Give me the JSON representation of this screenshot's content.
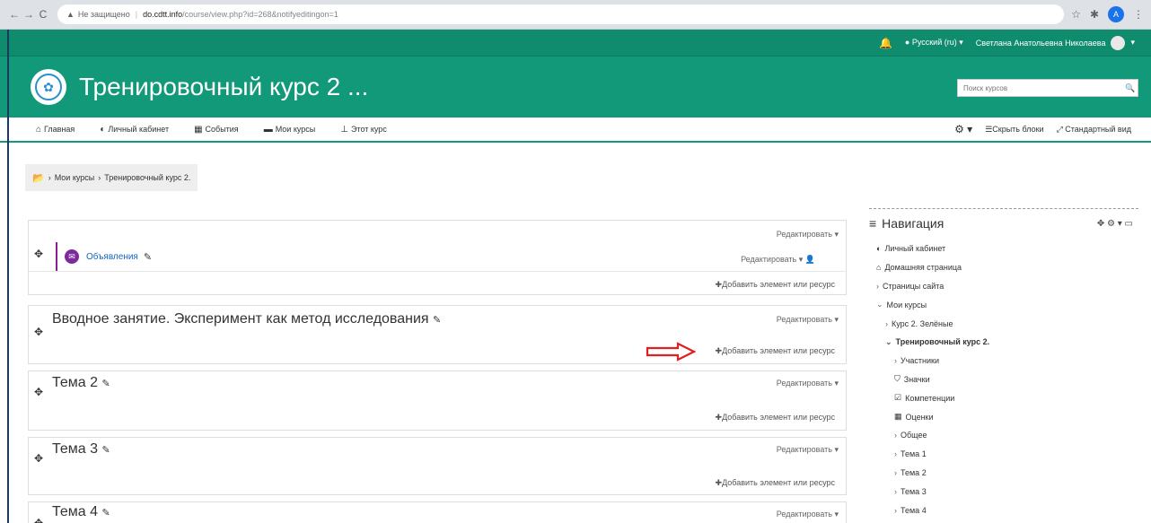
{
  "browser": {
    "back": "←",
    "forward": "→",
    "reload": "C",
    "security_warning": "Не защищено",
    "url_host": "do.cdtt.info",
    "url_path": "/course/view.php?id=268&notifyeditingon=1",
    "profile_initial": "A"
  },
  "topbar": {
    "language": "Русский (ru)",
    "user_name": "Светлана Анатольевна Николаева"
  },
  "header": {
    "course_title": "Тренировочный курс 2 ...",
    "search_placeholder": "Поиск курсов"
  },
  "navbar": {
    "items": [
      {
        "icon": "home-icon",
        "label": "Главная"
      },
      {
        "icon": "dashboard-icon",
        "label": "Личный кабинет"
      },
      {
        "icon": "calendar-icon",
        "label": "События"
      },
      {
        "icon": "courses-icon",
        "label": "Мои курсы"
      },
      {
        "icon": "sitemap-icon",
        "label": "Этот курс"
      }
    ],
    "hide_blocks": "Скрыть блоки",
    "standard_view": "Стандартный вид"
  },
  "breadcrumb": {
    "items": [
      "Мои курсы",
      "Тренировочный курс 2."
    ]
  },
  "sections": [
    {
      "title": "",
      "edit_label": "Редактировать",
      "activity": {
        "label": "Объявления",
        "edit_label": "Редактировать"
      },
      "add_label": "Добавить элемент или ресурс"
    },
    {
      "title": "Вводное занятие. Эксперимент как метод исследования",
      "edit_label": "Редактировать",
      "add_label": "Добавить элемент или ресурс"
    },
    {
      "title": "Тема 2",
      "edit_label": "Редактировать",
      "add_label": "Добавить элемент или ресурс"
    },
    {
      "title": "Тема 3",
      "edit_label": "Редактировать",
      "add_label": "Добавить элемент или ресурс"
    },
    {
      "title": "Тема 4",
      "edit_label": "Редактировать"
    }
  ],
  "navigation_block": {
    "title": "Навигация",
    "items": [
      {
        "label": "Личный кабинет",
        "icon": "dashboard-icon",
        "level": 1
      },
      {
        "label": "Домашняя страница",
        "icon": "home-icon",
        "level": 1
      },
      {
        "label": "Страницы сайта",
        "icon": "chevron-right-icon",
        "level": 1
      },
      {
        "label": "Мои курсы",
        "icon": "chevron-down-icon",
        "level": 1
      },
      {
        "label": "Курс 2. Зелёные",
        "icon": "chevron-right-icon",
        "level": 2
      },
      {
        "label": "Тренировочный курс 2.",
        "icon": "chevron-down-icon",
        "level": 2,
        "current": true
      },
      {
        "label": "Участники",
        "icon": "chevron-right-icon",
        "level": 3
      },
      {
        "label": "Значки",
        "icon": "shield-icon",
        "level": 3
      },
      {
        "label": "Компетенции",
        "icon": "checkbox-icon",
        "level": 3
      },
      {
        "label": "Оценки",
        "icon": "table-icon",
        "level": 3
      },
      {
        "label": "Общее",
        "icon": "chevron-right-icon",
        "level": 3
      },
      {
        "label": "Тема 1",
        "icon": "chevron-right-icon",
        "level": 3
      },
      {
        "label": "Тема 2",
        "icon": "chevron-right-icon",
        "level": 3
      },
      {
        "label": "Тема 3",
        "icon": "chevron-right-icon",
        "level": 3
      },
      {
        "label": "Тема 4",
        "icon": "chevron-right-icon",
        "level": 3
      }
    ]
  },
  "colors": {
    "brand_dark": "#0f8b6d",
    "brand": "#12997a",
    "link": "#1565c0",
    "annotation_arrow": "#e02020"
  }
}
